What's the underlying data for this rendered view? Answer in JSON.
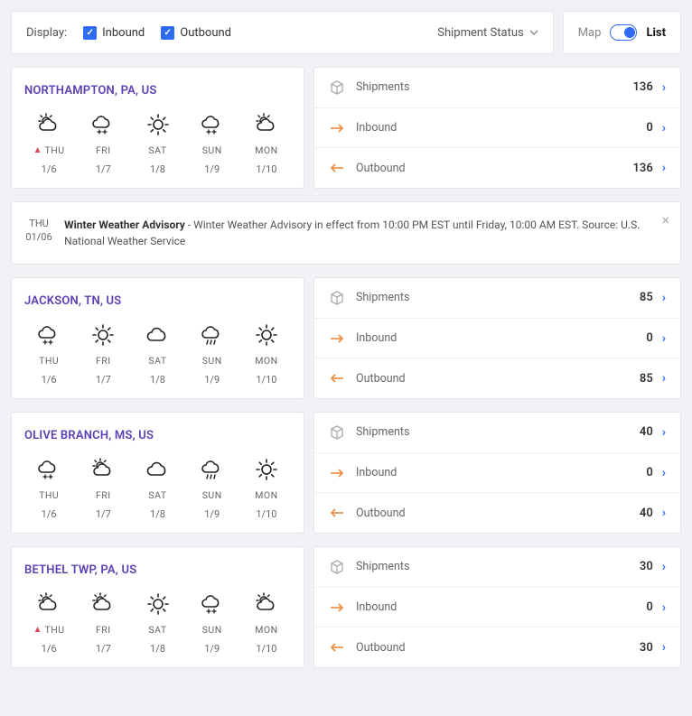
{
  "toolbar": {
    "display_label": "Display:",
    "inbound_label": "Inbound",
    "outbound_label": "Outbound",
    "status_label": "Shipment Status",
    "map_label": "Map",
    "list_label": "List"
  },
  "ship_labels": {
    "shipments": "Shipments",
    "inbound": "Inbound",
    "outbound": "Outbound"
  },
  "advisory": {
    "day": "THU",
    "date": "01/06",
    "title": "Winter Weather Advisory",
    "body": " - Winter Weather Advisory in effect from 10:00 PM EST until Friday, 10:00 AM EST. Source: U.S. National Weather Service"
  },
  "locations": [
    {
      "name": "NORTHAMPTON, PA, US",
      "days": [
        {
          "dow": "THU",
          "date": "1/6",
          "icon": "partly-sunny",
          "warn": true
        },
        {
          "dow": "FRI",
          "date": "1/7",
          "icon": "snow",
          "warn": false
        },
        {
          "dow": "SAT",
          "date": "1/8",
          "icon": "sunny",
          "warn": false
        },
        {
          "dow": "SUN",
          "date": "1/9",
          "icon": "snow",
          "warn": false
        },
        {
          "dow": "MON",
          "date": "1/10",
          "icon": "partly-sunny",
          "warn": false
        }
      ],
      "shipments": 136,
      "inbound": 0,
      "outbound": 136
    },
    {
      "name": "JACKSON, TN, US",
      "days": [
        {
          "dow": "THU",
          "date": "1/6",
          "icon": "snow",
          "warn": false
        },
        {
          "dow": "FRI",
          "date": "1/7",
          "icon": "sunny",
          "warn": false
        },
        {
          "dow": "SAT",
          "date": "1/8",
          "icon": "cloudy",
          "warn": false
        },
        {
          "dow": "SUN",
          "date": "1/9",
          "icon": "rain",
          "warn": false
        },
        {
          "dow": "MON",
          "date": "1/10",
          "icon": "sunny",
          "warn": false
        }
      ],
      "shipments": 85,
      "inbound": 0,
      "outbound": 85
    },
    {
      "name": "OLIVE BRANCH, MS, US",
      "days": [
        {
          "dow": "THU",
          "date": "1/6",
          "icon": "snow",
          "warn": false
        },
        {
          "dow": "FRI",
          "date": "1/7",
          "icon": "partly-sunny",
          "warn": false
        },
        {
          "dow": "SAT",
          "date": "1/8",
          "icon": "cloudy",
          "warn": false
        },
        {
          "dow": "SUN",
          "date": "1/9",
          "icon": "rain",
          "warn": false
        },
        {
          "dow": "MON",
          "date": "1/10",
          "icon": "sunny",
          "warn": false
        }
      ],
      "shipments": 40,
      "inbound": 0,
      "outbound": 40
    },
    {
      "name": "BETHEL TWP, PA, US",
      "days": [
        {
          "dow": "THU",
          "date": "1/6",
          "icon": "partly-sunny",
          "warn": true
        },
        {
          "dow": "FRI",
          "date": "1/7",
          "icon": "partly-sunny",
          "warn": false
        },
        {
          "dow": "SAT",
          "date": "1/8",
          "icon": "sunny",
          "warn": false
        },
        {
          "dow": "SUN",
          "date": "1/9",
          "icon": "snow",
          "warn": false
        },
        {
          "dow": "MON",
          "date": "1/10",
          "icon": "partly-sunny",
          "warn": false
        }
      ],
      "shipments": 30,
      "inbound": 0,
      "outbound": 30
    }
  ]
}
